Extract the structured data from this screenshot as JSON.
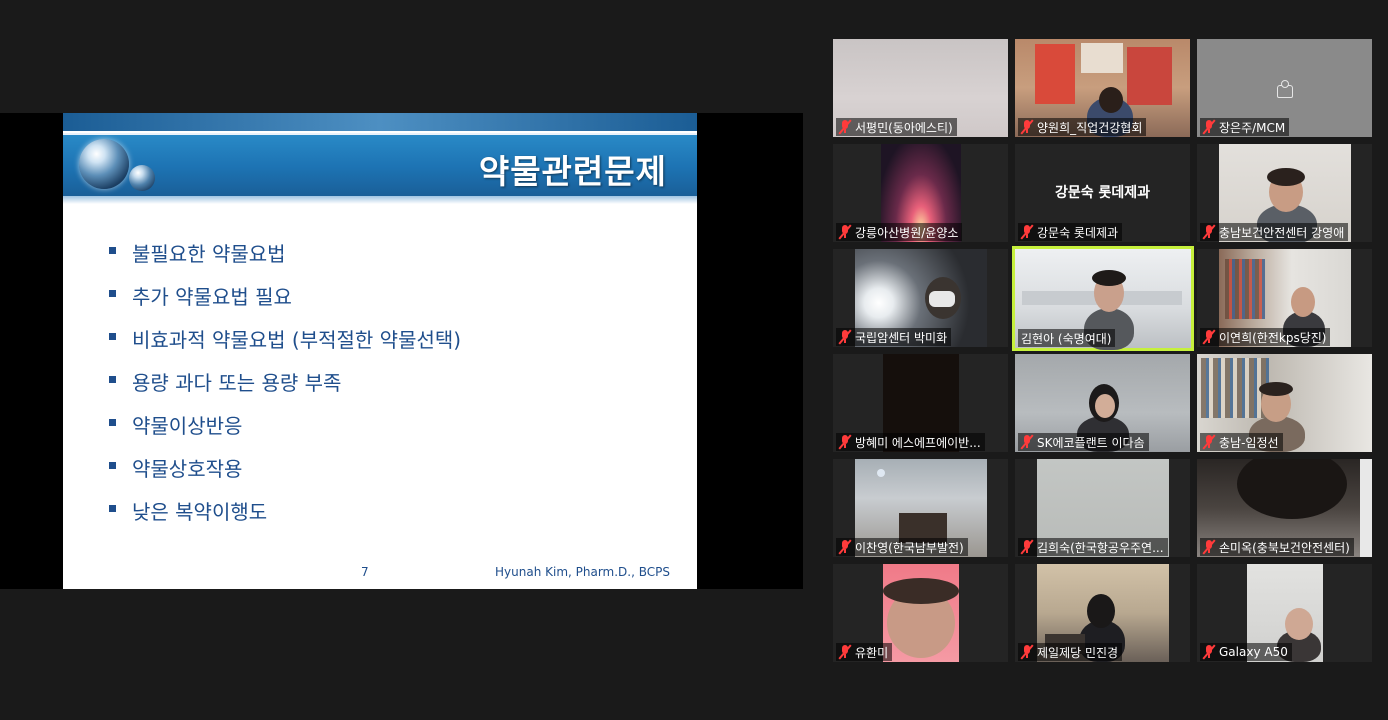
{
  "slide": {
    "title": "약물관련문제",
    "bullets": [
      "불필요한 약물요법",
      "추가 약물요법 필요",
      "비효과적 약물요법 (부적절한 약물선택)",
      "용량 과다 또는 용량 부족",
      "약물이상반응",
      "약물상호작용",
      "낮은 복약이행도"
    ],
    "page_number": "7",
    "author": "Hyunah Kim, Pharm.D., BCPS"
  },
  "participants": [
    {
      "name": "서평민(동아에스티)",
      "mic_muted": true
    },
    {
      "name": "양원희_직업건강협회",
      "mic_muted": true
    },
    {
      "name": "장은주/MCM",
      "mic_muted": true,
      "icon": "avatar-icon"
    },
    {
      "name": "강릉아산병원/윤양소",
      "mic_muted": true
    },
    {
      "name": "강문숙 롯데제과",
      "mic_muted": true,
      "center_name": "강문숙 롯데제과"
    },
    {
      "name": "충남보건안전센터 강영애",
      "mic_muted": true
    },
    {
      "name": "국립암센터 박미화",
      "mic_muted": true
    },
    {
      "name": "김현아 (숙명여대)",
      "mic_muted": false,
      "active_speaker": true
    },
    {
      "name": "이연희(한전kps당진)",
      "mic_muted": true
    },
    {
      "name": "방혜미 에스에프에이반...",
      "mic_muted": true
    },
    {
      "name": "SK에코플랜트 이다솜",
      "mic_muted": true
    },
    {
      "name": "충남-임정선",
      "mic_muted": true
    },
    {
      "name": "이찬영(한국남부발전)",
      "mic_muted": true
    },
    {
      "name": "김희숙(한국항공우주연...",
      "mic_muted": true
    },
    {
      "name": "손미옥(충북보건안전센터)",
      "mic_muted": true
    },
    {
      "name": "유환미",
      "mic_muted": true
    },
    {
      "name": "제일제당 민진경",
      "mic_muted": true
    },
    {
      "name": "Galaxy A50",
      "mic_muted": true
    }
  ],
  "colors": {
    "background": "#1a1a1a",
    "active_speaker_border": "#c6f03c",
    "muted_mic": "#ff3b3b",
    "slide_text": "#1f4e8c"
  }
}
